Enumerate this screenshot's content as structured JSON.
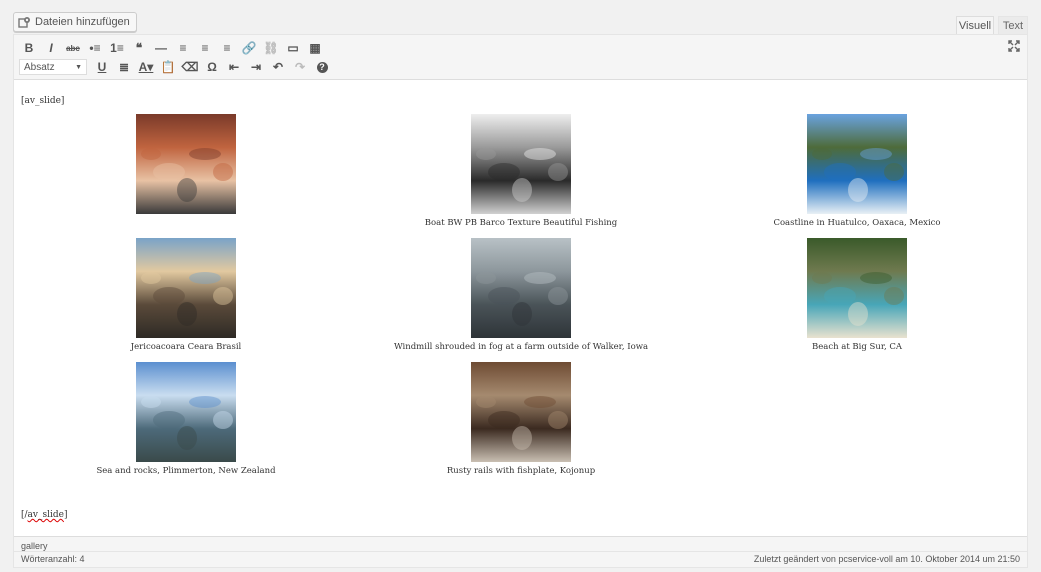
{
  "media_button": {
    "label": "Dateien hinzufügen",
    "icon": "media-icon"
  },
  "tabs": [
    {
      "label": "Visuell"
    },
    {
      "label": "Text"
    }
  ],
  "toolbar": {
    "row1": [
      {
        "name": "bold-button",
        "glyph": "B"
      },
      {
        "name": "italic-button",
        "glyph": "I"
      },
      {
        "name": "strikethrough-button",
        "glyph": "abc"
      },
      {
        "name": "bullet-list-button",
        "glyph": "•≡"
      },
      {
        "name": "numbered-list-button",
        "glyph": "1≡"
      },
      {
        "name": "blockquote-button",
        "glyph": "❝"
      },
      {
        "name": "horizontal-line-button",
        "glyph": "—"
      },
      {
        "name": "align-left-button",
        "glyph": "≡"
      },
      {
        "name": "align-center-button",
        "glyph": "≡"
      },
      {
        "name": "align-right-button",
        "glyph": "≡"
      },
      {
        "name": "insert-link-button",
        "glyph": "🔗",
        "disabled": true
      },
      {
        "name": "remove-link-button",
        "glyph": "⛓",
        "disabled": true
      },
      {
        "name": "read-more-button",
        "glyph": "▭"
      },
      {
        "name": "toolbar-toggle-button",
        "glyph": "▦"
      }
    ],
    "format_select": "Absatz",
    "row2": [
      {
        "name": "underline-button",
        "glyph": "U"
      },
      {
        "name": "justify-button",
        "glyph": "≣"
      },
      {
        "name": "text-color-button",
        "glyph": "A▾"
      },
      {
        "name": "paste-text-button",
        "glyph": "📋"
      },
      {
        "name": "clear-formatting-button",
        "glyph": "⌫"
      },
      {
        "name": "special-character-button",
        "glyph": "Ω"
      },
      {
        "name": "outdent-button",
        "glyph": "⇤"
      },
      {
        "name": "indent-button",
        "glyph": "⇥"
      },
      {
        "name": "undo-button",
        "glyph": "↶"
      },
      {
        "name": "redo-button",
        "glyph": "↷",
        "disabled": true
      },
      {
        "name": "help-button",
        "glyph": "?"
      }
    ]
  },
  "content": {
    "shortcode_open": "[av_slide]",
    "shortcode_close": "[/av_slide]",
    "gallery": [
      {
        "caption": "",
        "colors": [
          "#7a3a2a",
          "#c0643f",
          "#e8c2a4",
          "#3a3a3a"
        ]
      },
      {
        "caption": "Boat BW PB Barco Texture Beautiful Fishing",
        "colors": [
          "#eeeeee",
          "#9a9a9a",
          "#2a2a2a",
          "#d0d0d0"
        ]
      },
      {
        "caption": "Coastline in Huatulco, Oaxaca, Mexico",
        "colors": [
          "#6aa3e0",
          "#4e6b3a",
          "#1f6fbf",
          "#e8f0f5"
        ]
      },
      {
        "caption": "Jericoacoara Ceara Brasil",
        "colors": [
          "#7aa3c8",
          "#e2c9a0",
          "#5a4a3a",
          "#2e2a25"
        ]
      },
      {
        "caption": "Windmill shrouded in fog at a farm outside of Walker, Iowa",
        "colors": [
          "#b8c1c6",
          "#8d979c",
          "#4a5358",
          "#2e3438"
        ]
      },
      {
        "caption": "Beach at Big Sur, CA",
        "colors": [
          "#3a5a2a",
          "#6f7a4f",
          "#48a6b8",
          "#e9e2cf"
        ]
      },
      {
        "caption": "Sea and rocks, Plimmerton, New Zealand",
        "colors": [
          "#5b8fcf",
          "#c9ddf0",
          "#4d6a7a",
          "#3a4a4a"
        ]
      },
      {
        "caption": "Rusty rails with fishplate, Kojonup",
        "colors": [
          "#6e4b33",
          "#a58a6f",
          "#3b2a20",
          "#c9bfb2"
        ]
      }
    ]
  },
  "status": {
    "path": "gallery",
    "word_count": "Wörteranzahl: 4",
    "last_edited": "Zuletzt geändert von pcservice-voll am 10. Oktober 2014 um 21:50"
  }
}
